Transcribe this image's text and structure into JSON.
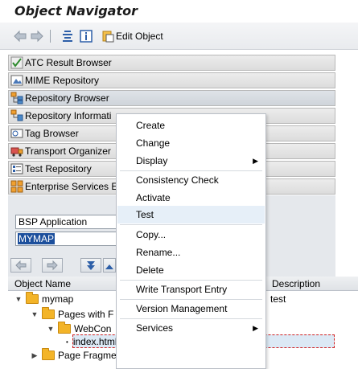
{
  "window": {
    "title": "Object Navigator"
  },
  "toolbar": {
    "edit_object_label": "Edit Object"
  },
  "browsers": [
    {
      "label": "ATC Result Browser"
    },
    {
      "label": "MIME Repository"
    },
    {
      "label": "Repository Browser"
    },
    {
      "label": "Repository Informati"
    },
    {
      "label": "Tag Browser"
    },
    {
      "label": "Transport Organizer"
    },
    {
      "label": "Test Repository"
    },
    {
      "label": "Enterprise Services E"
    }
  ],
  "object_type": {
    "value": "BSP Application"
  },
  "object_name": {
    "value": "MYMAP"
  },
  "tree": {
    "columns": {
      "name": "Object Name",
      "description": "Description"
    },
    "rows": [
      {
        "label": "mymap",
        "description": "test"
      },
      {
        "label": "Pages with F"
      },
      {
        "label": "WebCon"
      },
      {
        "label": "index.html"
      },
      {
        "label": "Page Fragments"
      }
    ]
  },
  "context_menu": {
    "items": [
      {
        "label": "Create"
      },
      {
        "label": "Change"
      },
      {
        "label": "Display",
        "submenu": true
      },
      {
        "label": "Consistency Check"
      },
      {
        "label": "Activate"
      },
      {
        "label": "Test"
      },
      {
        "label": "Copy..."
      },
      {
        "label": "Rename..."
      },
      {
        "label": "Delete"
      },
      {
        "label": "Write Transport Entry"
      },
      {
        "label": "Version Management"
      },
      {
        "label": "Services",
        "submenu": true
      }
    ],
    "hovered": "Test"
  }
}
